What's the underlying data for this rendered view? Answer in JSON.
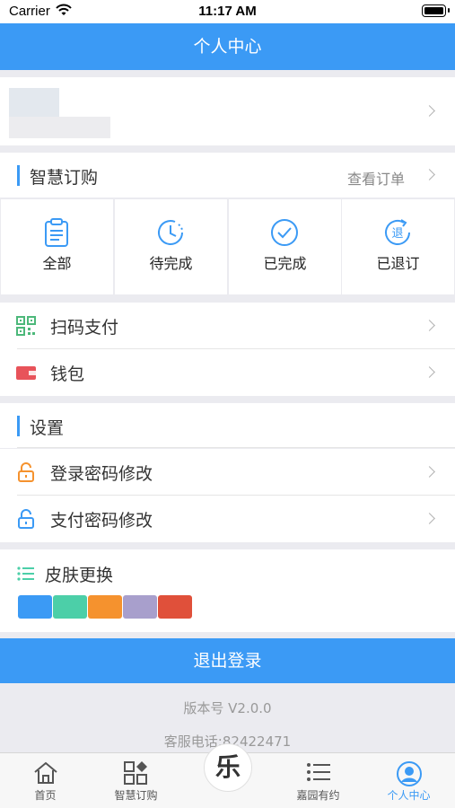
{
  "status_bar": {
    "carrier": "Carrier",
    "time": "11:17 AM"
  },
  "nav": {
    "title": "个人中心"
  },
  "orders": {
    "title": "智慧订购",
    "link": "查看订单",
    "items": [
      {
        "label": "全部",
        "icon": "clipboard-icon"
      },
      {
        "label": "待完成",
        "icon": "clock-icon"
      },
      {
        "label": "已完成",
        "icon": "check-circle-icon"
      },
      {
        "label": "已退订",
        "icon": "refund-icon"
      }
    ]
  },
  "payment": {
    "items": [
      {
        "label": "扫码支付",
        "icon": "qr-code-icon"
      },
      {
        "label": "钱包",
        "icon": "wallet-icon"
      }
    ]
  },
  "settings": {
    "title": "设置",
    "items": [
      {
        "label": "登录密码修改",
        "icon": "lock-icon"
      },
      {
        "label": "支付密码修改",
        "icon": "lock-icon"
      }
    ]
  },
  "skin": {
    "title": "皮肤更换",
    "colors": [
      "#3b9af5",
      "#4ccfa8",
      "#f5922e",
      "#a89fcc",
      "#e0503a"
    ]
  },
  "logout_label": "退出登录",
  "footer": {
    "version": "版本号 V2.0.0",
    "phone": "客服电话:82422471"
  },
  "tabbar": {
    "items": [
      {
        "label": "首页",
        "icon": "home-icon",
        "active": false
      },
      {
        "label": "智慧订购",
        "icon": "grid-icon",
        "active": false
      },
      {
        "label": "",
        "icon": "le-logo",
        "active": false
      },
      {
        "label": "嘉园有约",
        "icon": "list-icon",
        "active": false
      },
      {
        "label": "个人中心",
        "icon": "person-icon",
        "active": true
      }
    ],
    "center_glyph": "乐"
  },
  "colors": {
    "accent": "#3b9af5",
    "background": "#ebebf0"
  }
}
